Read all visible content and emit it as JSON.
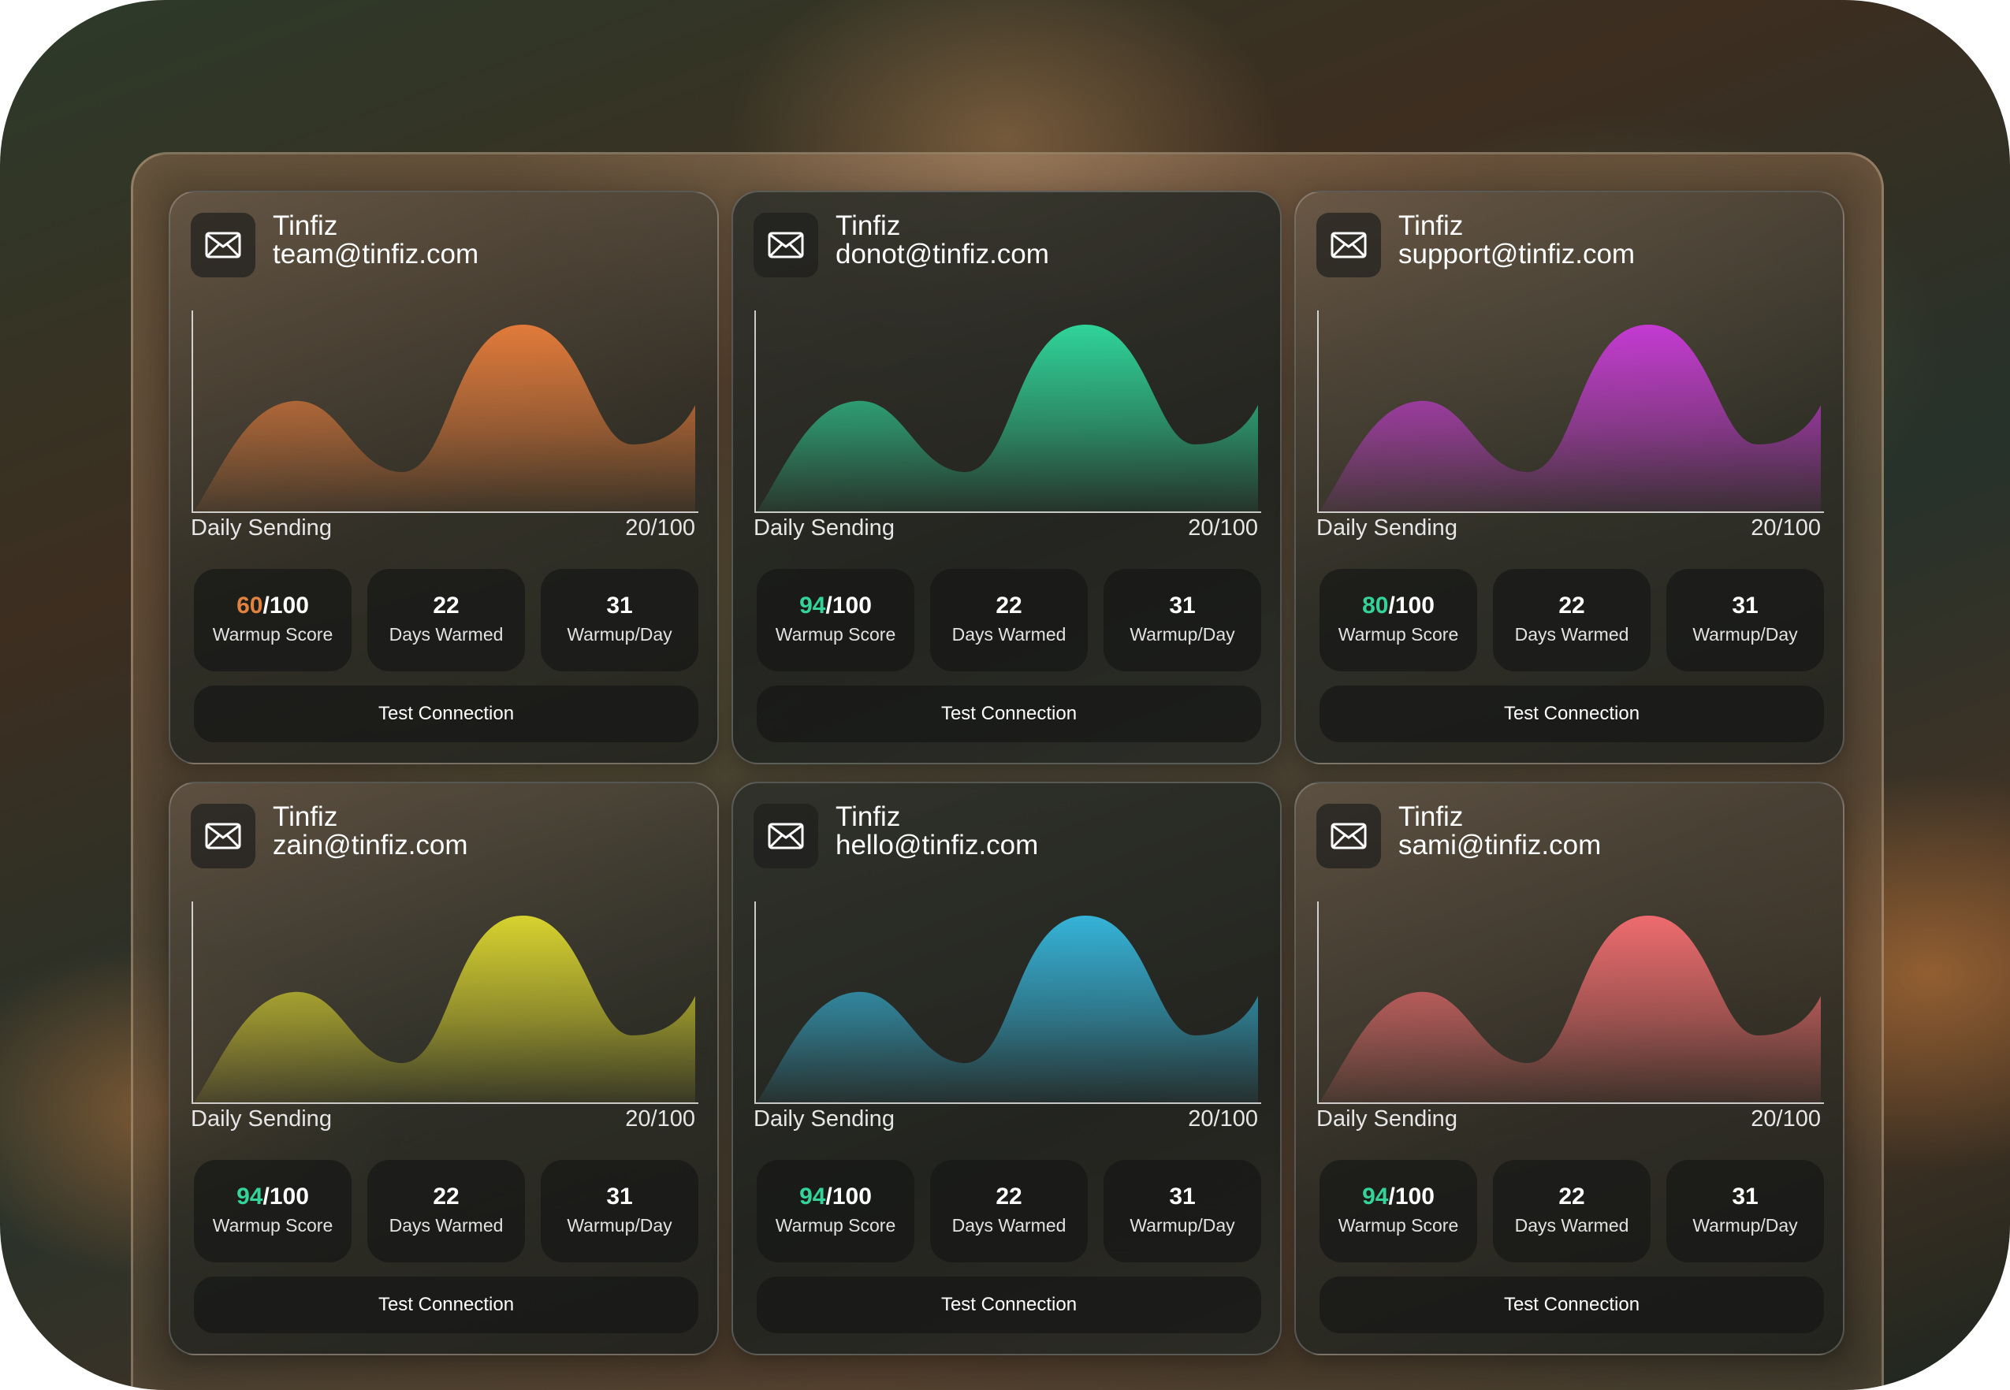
{
  "daily_sending_label": "Daily Sending",
  "button_label": "Test Connection",
  "cards": [
    {
      "name": "Tinfiz",
      "email": "team@tinfiz.com",
      "daily_sending": "20/100",
      "score": "60",
      "score_max": "/100",
      "score_label": "Warmup Score",
      "score_color": "#e2823f",
      "days": "22",
      "days_label": "Days Warmed",
      "per_day": "31",
      "per_day_label": "Warmup/Day",
      "chart_color": "#e17a3a",
      "icon": "mail-icon"
    },
    {
      "name": "Tinfiz",
      "email": "donot@tinfiz.com",
      "daily_sending": "20/100",
      "score": "94",
      "score_max": "/100",
      "score_label": "Warmup Score",
      "score_color": "#34d39a",
      "days": "22",
      "days_label": "Days Warmed",
      "per_day": "31",
      "per_day_label": "Warmup/Day",
      "chart_color": "#2fd49a",
      "icon": "mail-icon"
    },
    {
      "name": "Tinfiz",
      "email": "support@tinfiz.com",
      "daily_sending": "20/100",
      "score": "80",
      "score_max": "/100",
      "score_label": "Warmup Score",
      "score_color": "#34d39a",
      "days": "22",
      "days_label": "Days Warmed",
      "per_day": "31",
      "per_day_label": "Warmup/Day",
      "chart_color": "#c43ad2",
      "icon": "mail-icon"
    },
    {
      "name": "Tinfiz",
      "email": "zain@tinfiz.com",
      "daily_sending": "20/100",
      "score": "94",
      "score_max": "/100",
      "score_label": "Warmup Score",
      "score_color": "#34d39a",
      "days": "22",
      "days_label": "Days Warmed",
      "per_day": "31",
      "per_day_label": "Warmup/Day",
      "chart_color": "#d7d22e",
      "icon": "mail-icon"
    },
    {
      "name": "Tinfiz",
      "email": "hello@tinfiz.com",
      "daily_sending": "20/100",
      "score": "94",
      "score_max": "/100",
      "score_label": "Warmup Score",
      "score_color": "#34d39a",
      "days": "22",
      "days_label": "Days Warmed",
      "per_day": "31",
      "per_day_label": "Warmup/Day",
      "chart_color": "#35b3d8",
      "icon": "mail-icon"
    },
    {
      "name": "Tinfiz",
      "email": "sami@tinfiz.com",
      "daily_sending": "20/100",
      "score": "94",
      "score_max": "/100",
      "score_label": "Warmup Score",
      "score_color": "#34d39a",
      "days": "22",
      "days_label": "Days Warmed",
      "per_day": "31",
      "per_day_label": "Warmup/Day",
      "chart_color": "#ee6b6e",
      "icon": "mail-icon"
    }
  ]
}
